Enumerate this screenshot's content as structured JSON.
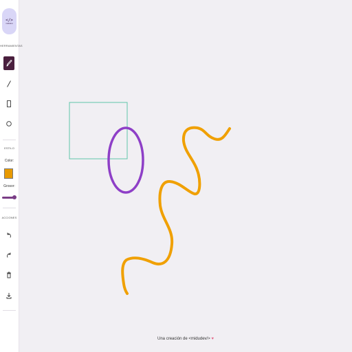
{
  "sidebar": {
    "logo": {
      "brackets": "</>",
      "text": "midudev/"
    },
    "sections": {
      "tools": "HERRAMIENTAS",
      "style": "ESTILO",
      "actions": "ACCIONES"
    },
    "tools": [
      {
        "name": "pencil",
        "icon": "pencil-icon",
        "active": true
      },
      {
        "name": "line",
        "icon": "line-icon",
        "active": false
      },
      {
        "name": "rectangle",
        "icon": "rectangle-icon",
        "active": false
      },
      {
        "name": "ellipse",
        "icon": "ellipse-icon",
        "active": false
      }
    ],
    "style": {
      "color_label": "Color:",
      "color_value": "#e89a00",
      "size_label": "Grosor:",
      "size_fraction": 0.9
    },
    "actions": [
      {
        "name": "undo",
        "icon": "undo-icon"
      },
      {
        "name": "redo",
        "icon": "redo-icon"
      },
      {
        "name": "clear",
        "icon": "trash-icon"
      },
      {
        "name": "download",
        "icon": "download-icon"
      }
    ]
  },
  "canvas": {
    "colors": {
      "rectangle": "#5fc4a8",
      "ellipse": "#8e3fc7",
      "stroke": "#f0a000"
    }
  },
  "footer": {
    "text": "Una creación de <midudev/> ",
    "heart": "♥"
  }
}
